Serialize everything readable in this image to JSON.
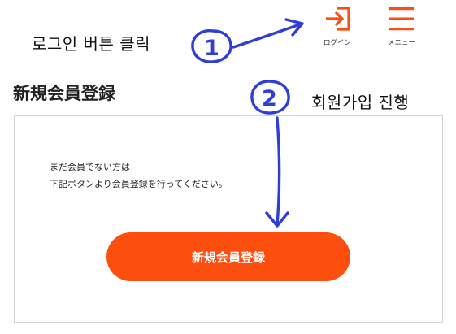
{
  "header": {
    "login_label": "ログイン",
    "menu_label": "メニュー",
    "accent_color": "#fb4e0f"
  },
  "annotations": {
    "step1_text": "로그인 버튼 클릭",
    "step1_number": "1",
    "step2_text": "회원가입 진행",
    "step2_number": "2",
    "pen_color": "#2f3ed4"
  },
  "main": {
    "title": "新規会員登録",
    "description_line1": "まだ会員でない方は",
    "description_line2": "下記ボタンより会員登録を行ってください。",
    "register_button_label": "新規会員登録"
  }
}
